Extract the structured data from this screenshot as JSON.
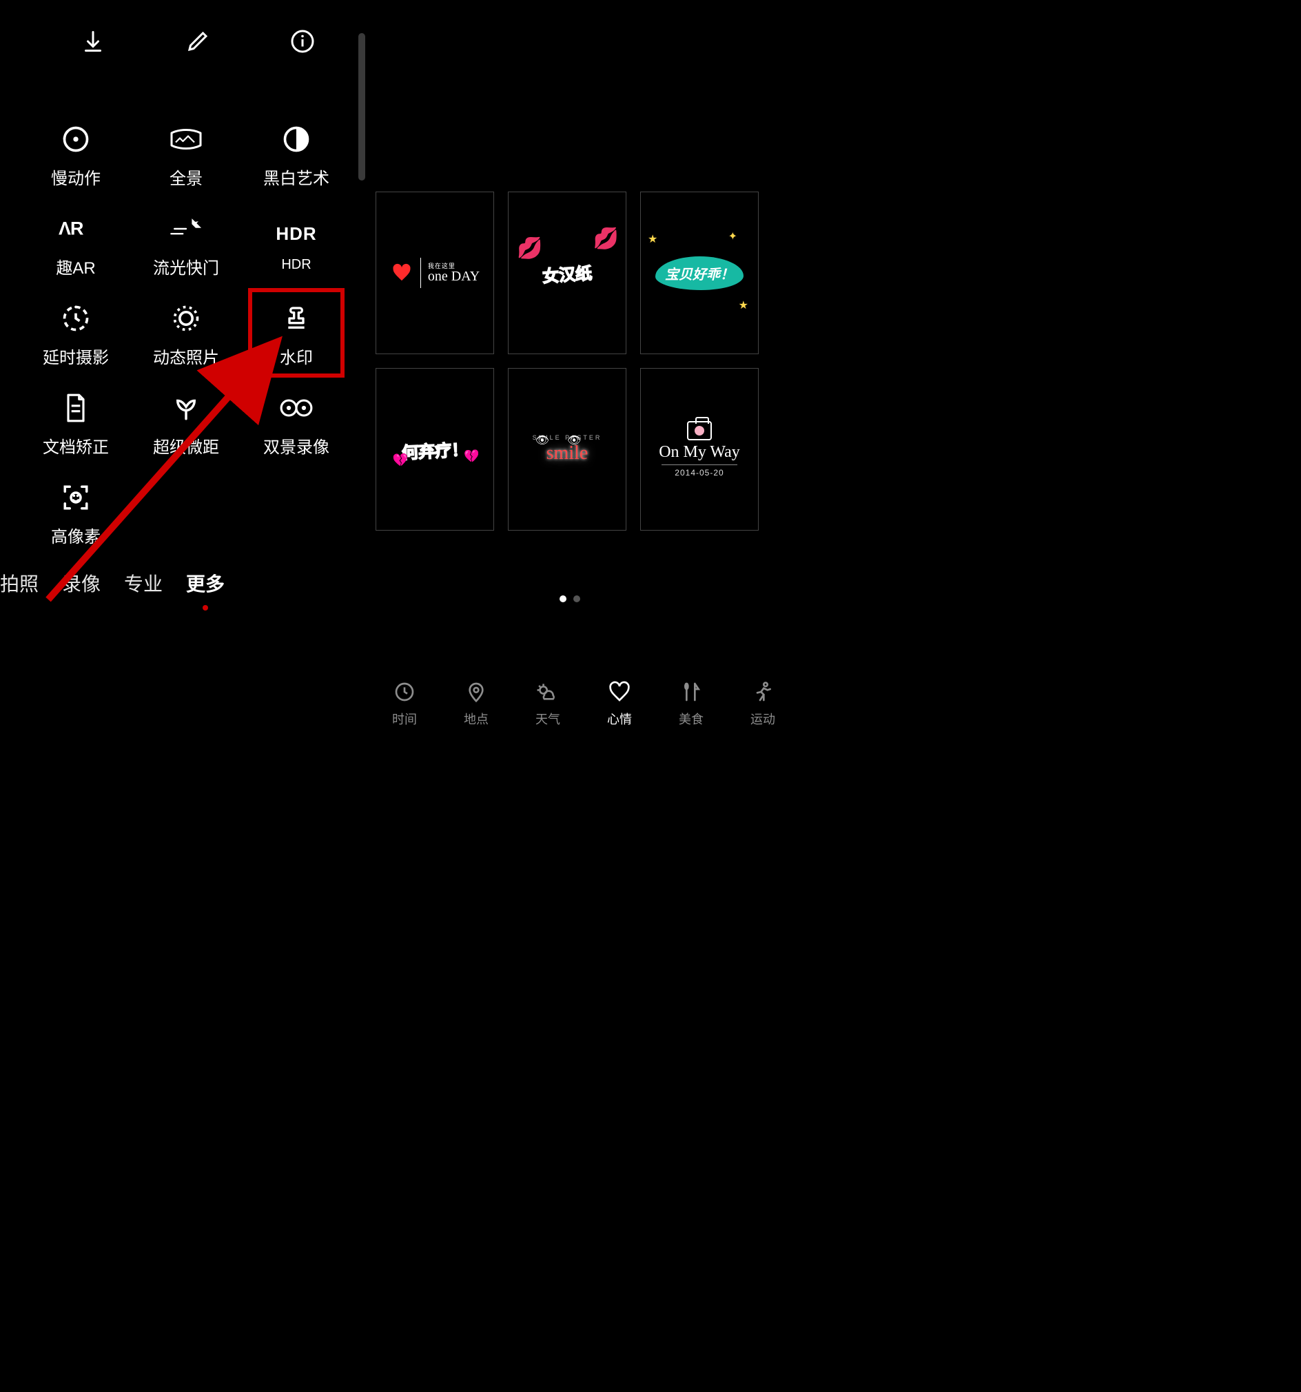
{
  "left": {
    "top_icons": [
      "download",
      "edit",
      "info"
    ],
    "modes": [
      {
        "id": "slowmo",
        "label": "慢动作"
      },
      {
        "id": "panorama",
        "label": "全景"
      },
      {
        "id": "bw",
        "label": "黑白艺术"
      },
      {
        "id": "ar",
        "label": "趣AR"
      },
      {
        "id": "light",
        "label": "流光快门"
      },
      {
        "id": "hdr",
        "label": "HDR",
        "sublabel": "HDR"
      },
      {
        "id": "timelapse",
        "label": "延时摄影"
      },
      {
        "id": "moving",
        "label": "动态照片"
      },
      {
        "id": "watermark",
        "label": "水印",
        "highlight": true
      },
      {
        "id": "docfix",
        "label": "文档矫正"
      },
      {
        "id": "macro",
        "label": "超级微距"
      },
      {
        "id": "dualview",
        "label": "双景录像"
      },
      {
        "id": "hires",
        "label": "高像素"
      }
    ],
    "tabs": [
      "拍照",
      "录像",
      "专业",
      "更多"
    ],
    "active_tab_index": 3
  },
  "right": {
    "watermarks": [
      {
        "id": "oneday",
        "small": "我在这里",
        "big": "one DAY"
      },
      {
        "id": "nvhz",
        "text": "女汉纸"
      },
      {
        "id": "bbhg",
        "text": "宝贝好乖！"
      },
      {
        "id": "hql",
        "text": "何弃疗！"
      },
      {
        "id": "smile",
        "arc": "SMILE PASTER",
        "main": "smile"
      },
      {
        "id": "onmyway",
        "title": "On My Way",
        "date": "2014-05-20"
      }
    ],
    "page_dots": 2,
    "active_dot": 0,
    "categories": [
      {
        "id": "time",
        "label": "时间"
      },
      {
        "id": "place",
        "label": "地点"
      },
      {
        "id": "weather",
        "label": "天气"
      },
      {
        "id": "mood",
        "label": "心情",
        "active": true
      },
      {
        "id": "food",
        "label": "美食"
      },
      {
        "id": "sport",
        "label": "运动"
      }
    ]
  }
}
